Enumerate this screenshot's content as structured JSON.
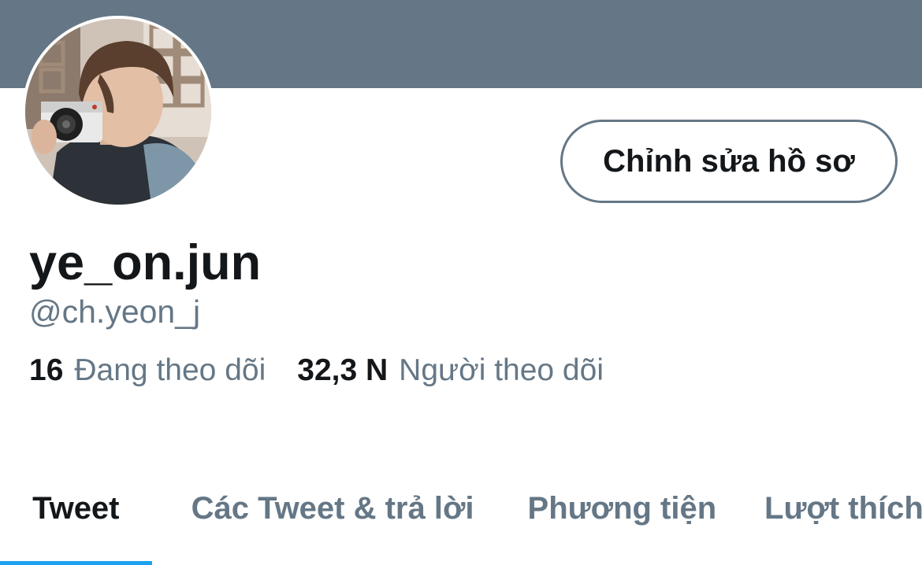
{
  "header": {
    "banner_color": "#657786"
  },
  "profile": {
    "avatar_icon": "profile-photo",
    "edit_button_label": "Chỉnh sửa hồ sơ",
    "display_name": "ye_on.jun",
    "handle": "@ch.yeon_j",
    "stats": {
      "following_count": "16",
      "following_label": "Đang theo dõi",
      "followers_count": "32,3 N",
      "followers_label": "Người theo dõi"
    }
  },
  "tabs": [
    {
      "label": "Tweet",
      "active": true
    },
    {
      "label": "Các Tweet & trả lời",
      "active": false
    },
    {
      "label": "Phương tiện",
      "active": false
    },
    {
      "label": "Lượt thích",
      "active": false
    }
  ],
  "colors": {
    "accent": "#1da1f2",
    "secondary_text": "#657786",
    "primary_text": "#14171a"
  }
}
